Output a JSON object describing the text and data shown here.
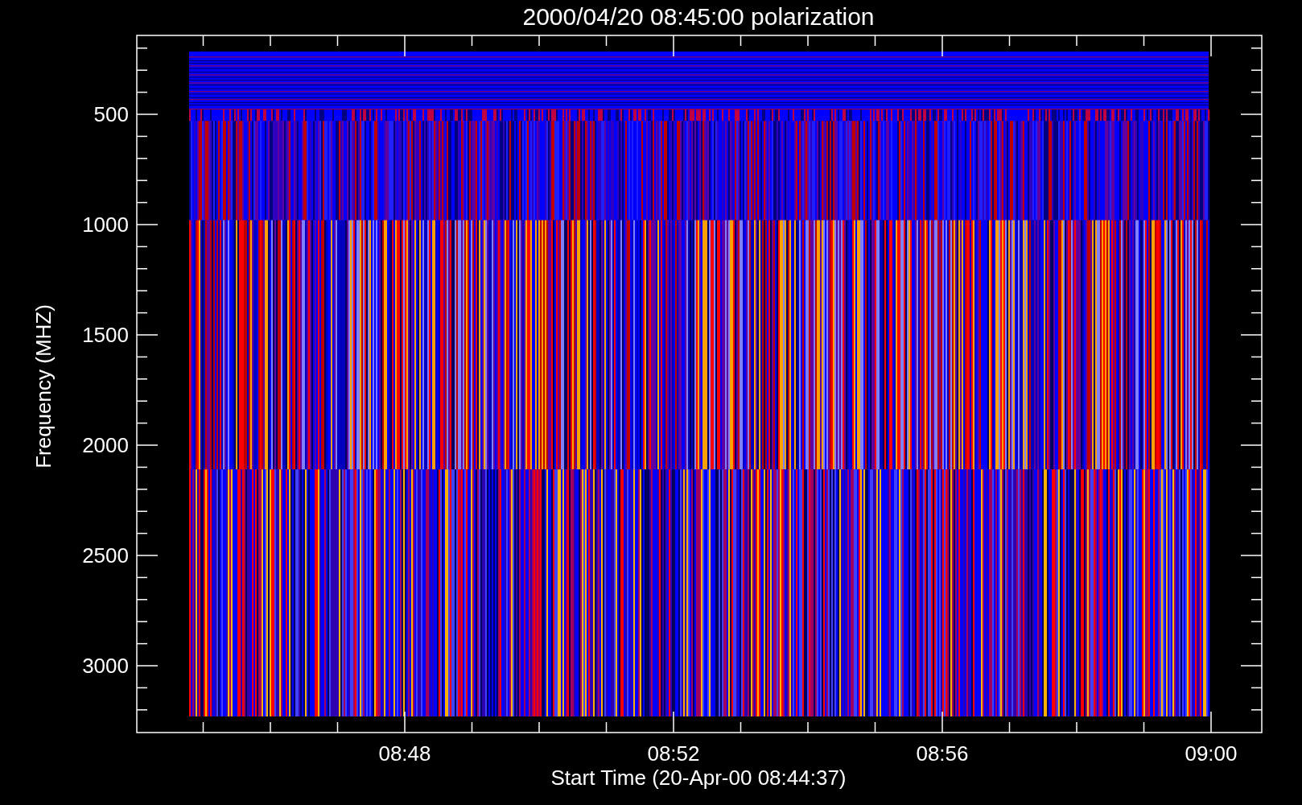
{
  "title": "2000/04/20 08:45:00 polarization",
  "y_axis": {
    "label": "Frequency (MHZ)",
    "ticks": [
      "500",
      "1000",
      "1500",
      "2000",
      "2500",
      "3000"
    ]
  },
  "x_axis": {
    "label": "Start Time (20-Apr-00 08:44:37)",
    "ticks": [
      "08:48",
      "08:52",
      "08:56",
      "09:00"
    ]
  }
}
